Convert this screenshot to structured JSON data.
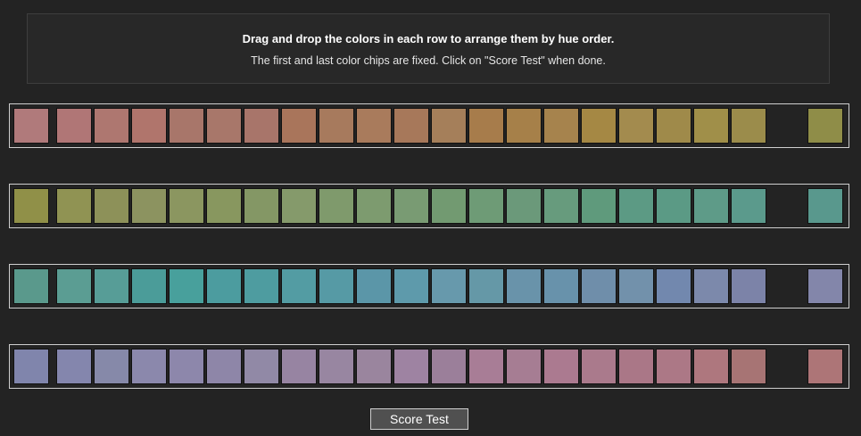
{
  "instructions": {
    "title": "Drag and drop the colors in each row to arrange them by hue order.",
    "subtitle": "The first and last color chips are fixed. Click on \"Score Test\" when done."
  },
  "rows": [
    {
      "colors": [
        "#b07a7b",
        "#b07676",
        "#ae7770",
        "#b0756c",
        "#a8766a",
        "#a8776a",
        "#a8756a",
        "#a9755b",
        "#a77a5d",
        "#a97b5c",
        "#a7785a",
        "#a57f5a",
        "#a77c4b",
        "#a68049",
        "#a6834d",
        "#a58844",
        "#a38b4e",
        "#9f8a4a",
        "#a08f49",
        "#9b8c4b",
        "#8f8d48"
      ]
    },
    {
      "colors": [
        "#909048",
        "#909353",
        "#8d9159",
        "#8c9360",
        "#8b9660",
        "#88975f",
        "#849765",
        "#859a6b",
        "#7f9a6c",
        "#7d9b6f",
        "#799b73",
        "#729a71",
        "#6e9b76",
        "#6b997a",
        "#679b7d",
        "#5f9a7c",
        "#5c9a84",
        "#5b9a85",
        "#5e9b88",
        "#5b9a8c",
        "#59988d"
      ]
    },
    {
      "colors": [
        "#5a998c",
        "#5b9d93",
        "#579d97",
        "#4b9c99",
        "#48a09c",
        "#4c9c9f",
        "#4e9ca0",
        "#539ca3",
        "#569aa5",
        "#5b96a8",
        "#5e9aab",
        "#6799ac",
        "#6598a7",
        "#6993aa",
        "#6892ab",
        "#6f8eaa",
        "#7291ab",
        "#7288ae",
        "#7c89ab",
        "#7c83a8",
        "#8386aa"
      ]
    },
    {
      "colors": [
        "#8085ac",
        "#8486ad",
        "#8689a9",
        "#8b88ac",
        "#8d87ab",
        "#8e86a8",
        "#9189a6",
        "#9784a2",
        "#9886a1",
        "#9a859e",
        "#9e83a2",
        "#9b7f9a",
        "#a87d96",
        "#a67d93",
        "#ab7a90",
        "#aa7a8c",
        "#aa7787",
        "#ac7886",
        "#ae777e",
        "#a77474",
        "#ad7577"
      ]
    }
  ],
  "score_button": {
    "label": "Score Test"
  }
}
